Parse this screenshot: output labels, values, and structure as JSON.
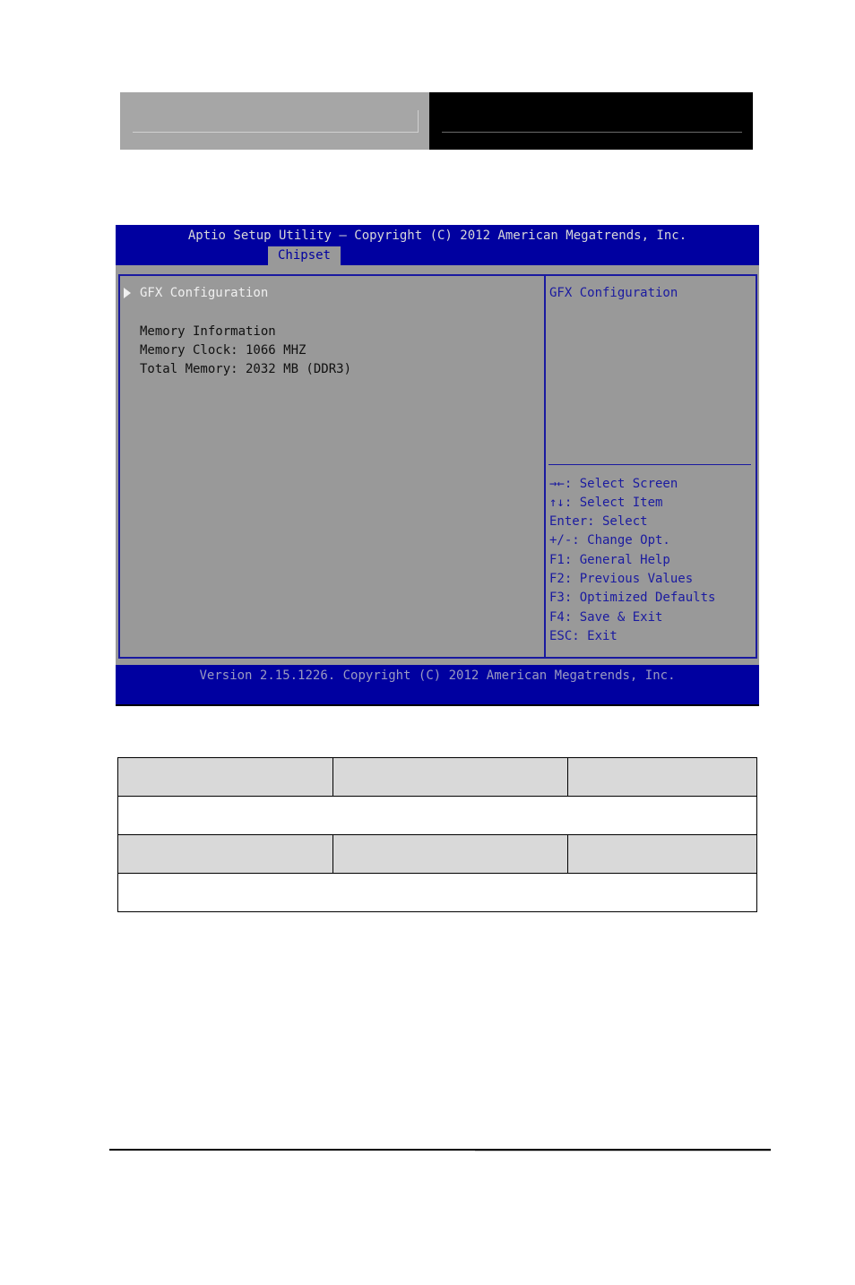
{
  "bios": {
    "title": "Aptio Setup Utility – Copyright (C) 2012 American Megatrends, Inc.",
    "active_tab": "Chipset",
    "left_panel": {
      "menu_item": "GFX Configuration",
      "info_lines": [
        "Memory Information",
        "Memory Clock: 1066 MHZ",
        "Total Memory: 2032 MB (DDR3)"
      ]
    },
    "right_panel": {
      "help_title": "GFX Configuration",
      "key_help": [
        "→←: Select Screen",
        "↑↓: Select Item",
        "Enter: Select",
        "+/-: Change Opt.",
        "F1: General Help",
        "F2: Previous Values",
        "F3: Optimized Defaults",
        "F4: Save & Exit",
        "ESC: Exit"
      ]
    },
    "version": "Version 2.15.1226. Copyright (C) 2012 American Megatrends, Inc."
  },
  "colors": {
    "bios_blue": "#0000a0",
    "bios_grey": "#999999",
    "help_text": "#1a1aa0",
    "table_header_fill": "#d9d9d9"
  },
  "table": {
    "rows": [
      {
        "type": "header",
        "cells": [
          "",
          "",
          ""
        ]
      },
      {
        "type": "description",
        "cells": [
          ""
        ]
      },
      {
        "type": "header",
        "cells": [
          "",
          "",
          ""
        ]
      },
      {
        "type": "description",
        "cells": [
          ""
        ]
      }
    ]
  }
}
